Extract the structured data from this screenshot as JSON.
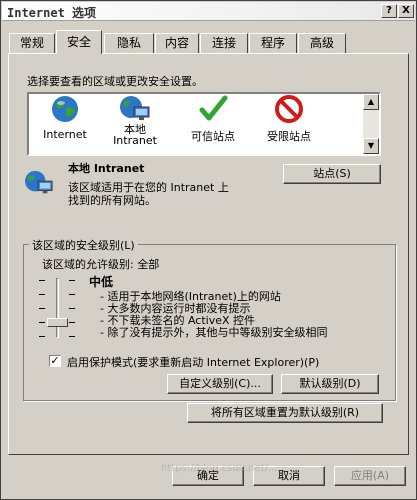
{
  "window": {
    "title": "Internet 选项",
    "help_button": "?",
    "close_button": "X"
  },
  "tabs": [
    {
      "label": "常规",
      "active": false
    },
    {
      "label": "安全",
      "active": true
    },
    {
      "label": "隐私",
      "active": false
    },
    {
      "label": "内容",
      "active": false
    },
    {
      "label": "连接",
      "active": false
    },
    {
      "label": "程序",
      "active": false
    },
    {
      "label": "高级",
      "active": false
    }
  ],
  "security": {
    "select_zone_prompt": "选择要查看的区域或更改安全设置。",
    "zones": [
      {
        "label": "Internet",
        "icon": "globe-icon"
      },
      {
        "label_line1": "本地",
        "label_line2": "Intranet",
        "icon": "local-intranet-icon"
      },
      {
        "label": "可信站点",
        "icon": "checkmark-icon"
      },
      {
        "label": "受限站点",
        "icon": "forbidden-icon"
      }
    ],
    "selected_zone": {
      "title": "本地 Intranet",
      "description_line1": "该区域适用于在您的 Intranet 上",
      "description_line2": "找到的所有网站。",
      "sites_button": "站点(S)"
    },
    "security_level_group": {
      "label": "该区域的安全级别(L)",
      "allowed_levels": "该区域的允许级别: 全部",
      "current_level": "中低",
      "slider_level": "2 of 5",
      "bullets": [
        "- 适用于本地网络(Intranet)上的网站",
        "- 大多数内容运行时都没有提示",
        "- 不下载未签名的 ActiveX 控件",
        "- 除了没有提示外，其他与中等级别安全级相同"
      ],
      "protected_mode_label": "启用保护模式(要求重新启动 Internet Explorer)(P)",
      "protected_mode_checked": true,
      "custom_level_button": "自定义级别(C)...",
      "default_level_button": "默认级别(D)"
    },
    "reset_all_button": "将所有区域重置为默认级别(R)"
  },
  "footer": {
    "ok_button": "确定",
    "cancel_button": "取消",
    "apply_button": "应用(A)"
  },
  "watermark": "https://blog.csdn.net/..."
}
